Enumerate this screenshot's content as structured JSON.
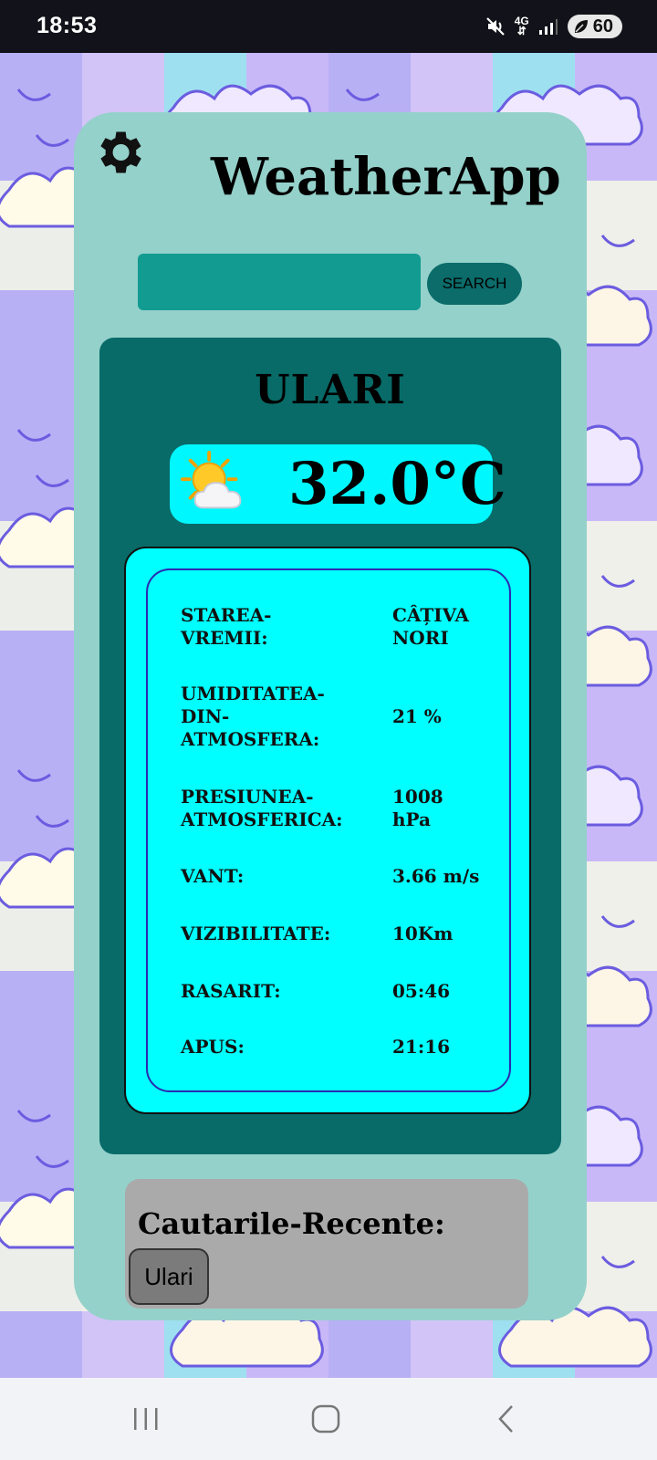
{
  "status": {
    "time": "18:53",
    "network": "4G",
    "battery": "60"
  },
  "app": {
    "title": "WeatherApp",
    "search": {
      "button_label": "SEARCH",
      "value": "",
      "placeholder": ""
    }
  },
  "weather": {
    "city": "ULARI",
    "temperature": "32.0°C",
    "icon": "sun-behind-cloud-icon",
    "details": [
      {
        "label": "STAREA-VREMII:",
        "value": "CÂȚIVA NORI"
      },
      {
        "label": "UMIDITATEA-DIN-ATMOSFERA:",
        "value": "21 %"
      },
      {
        "label": "PRESIUNEA-ATMOSFERICA:",
        "value": "1008 hPa"
      },
      {
        "label": "VANT:",
        "value": "3.66 m/s"
      },
      {
        "label": "VIZIBILITATE:",
        "value": "10Km"
      },
      {
        "label": "RASARIT:",
        "value": "05:46"
      },
      {
        "label": "APUS:",
        "value": "21:16"
      }
    ]
  },
  "recent": {
    "title": "Cautarile-Recente:",
    "items": [
      "Ulari"
    ]
  },
  "colors": {
    "card": "#94d1ca",
    "panel": "#086b68",
    "accent": "#00ffff",
    "search_field": "#129b91"
  }
}
